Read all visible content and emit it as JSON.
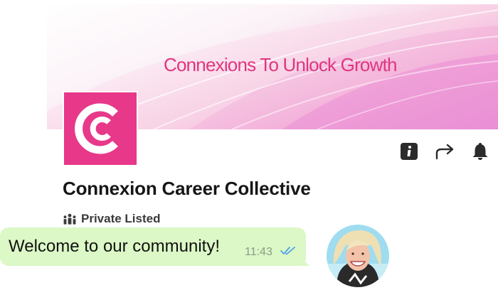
{
  "banner": {
    "tagline": "Connexions To Unlock Growth"
  },
  "logo": {
    "icon": "connexion-c-logo-icon"
  },
  "actions": [
    {
      "icon": "info-icon"
    },
    {
      "icon": "share-arrow-icon"
    },
    {
      "icon": "bell-icon"
    }
  ],
  "group": {
    "name": "Connexion Career Collective",
    "privacy_icon": "group-people-icon",
    "privacy": "Private Listed"
  },
  "message": {
    "text": "Welcome to our community!",
    "time": "11:43",
    "status_icon": "double-check-icon",
    "status_color": "#4fa3e6",
    "bubble_color": "#dbf8c6"
  },
  "colors": {
    "brand": "#e7388a",
    "tagline": "#e0357f"
  }
}
